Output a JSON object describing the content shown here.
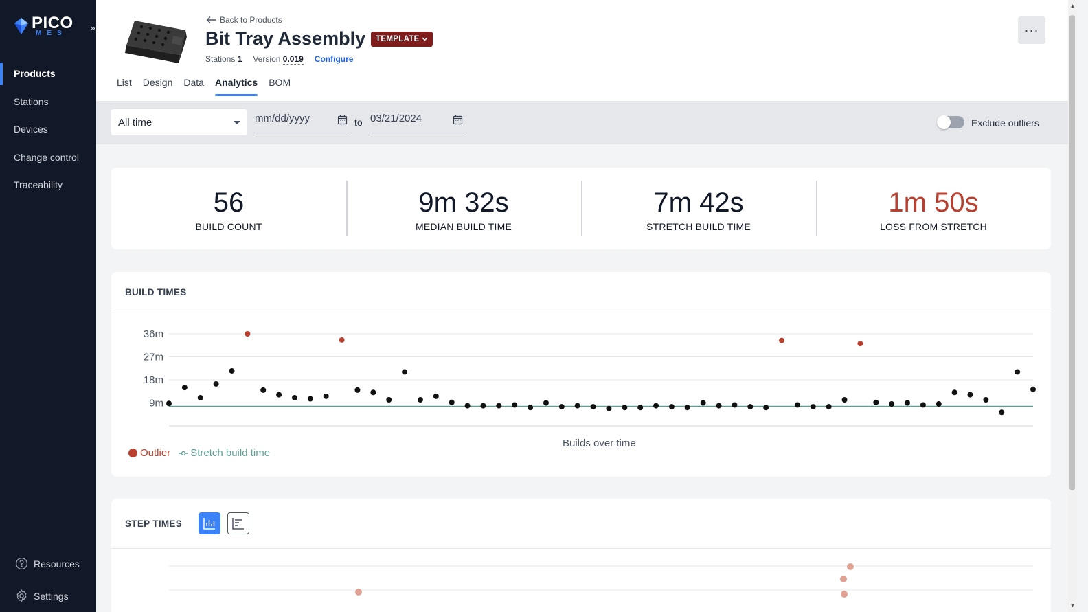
{
  "sidebar": {
    "logo_primary": "PICO",
    "logo_secondary": "MES",
    "collapse_icon": "»",
    "items": [
      {
        "label": "Products",
        "active": true
      },
      {
        "label": "Stations",
        "active": false
      },
      {
        "label": "Devices",
        "active": false
      },
      {
        "label": "Change control",
        "active": false
      },
      {
        "label": "Traceability",
        "active": false
      }
    ],
    "bottom_items": [
      {
        "label": "Resources",
        "icon": "help-circle-icon"
      },
      {
        "label": "Settings",
        "icon": "gear-icon"
      }
    ]
  },
  "header": {
    "back_link": "Back to Products",
    "title": "Bit Tray Assembly",
    "badge": "TEMPLATE",
    "stations_label": "Stations",
    "stations_value": "1",
    "version_label": "Version",
    "version_value": "0.019",
    "configure_label": "Configure",
    "more_label": "···",
    "tabs": [
      {
        "label": "List",
        "active": false
      },
      {
        "label": "Design",
        "active": false
      },
      {
        "label": "Data",
        "active": false
      },
      {
        "label": "Analytics",
        "active": true
      },
      {
        "label": "BOM",
        "active": false
      }
    ]
  },
  "filters": {
    "range_select": "All time",
    "date_from_placeholder": "mm/dd/yyyy",
    "to_label": "to",
    "date_to_value": "03/21/2024",
    "exclude_outliers_label": "Exclude outliers",
    "exclude_outliers_on": false
  },
  "stats": [
    {
      "value": "56",
      "label": "BUILD COUNT",
      "highlight": false
    },
    {
      "value": "9m 32s",
      "label": "MEDIAN BUILD TIME",
      "highlight": false
    },
    {
      "value": "7m 42s",
      "label": "STRETCH BUILD TIME",
      "highlight": false
    },
    {
      "value": "1m 50s",
      "label": "LOSS FROM STRETCH",
      "highlight": true
    }
  ],
  "colors": {
    "accent": "#3b82f6",
    "outlier": "#b9402f",
    "stretch": "#5e9f94",
    "point": "#111111",
    "loss": "#b9402f"
  },
  "build_times": {
    "section_title": "BUILD TIMES",
    "legend_outlier": "Outlier",
    "legend_stretch": "Stretch build time",
    "chart_data": {
      "type": "scatter",
      "xlabel": "Builds over time",
      "ylabel": "",
      "y_unit": "minutes",
      "yticks": [
        9,
        18,
        27,
        36
      ],
      "ytick_labels": [
        "9m",
        "18m",
        "27m",
        "36m"
      ],
      "ylim": [
        0,
        38
      ],
      "stretch_minutes": 7.7,
      "points": [
        {
          "i": 0,
          "y": 8.8,
          "outlier": false
        },
        {
          "i": 1,
          "y": 15.0,
          "outlier": false
        },
        {
          "i": 2,
          "y": 11.0,
          "outlier": false
        },
        {
          "i": 3,
          "y": 16.4,
          "outlier": false
        },
        {
          "i": 4,
          "y": 21.5,
          "outlier": false
        },
        {
          "i": 5,
          "y": 36.0,
          "outlier": true
        },
        {
          "i": 6,
          "y": 14.0,
          "outlier": false
        },
        {
          "i": 7,
          "y": 12.2,
          "outlier": false
        },
        {
          "i": 8,
          "y": 11.0,
          "outlier": false
        },
        {
          "i": 9,
          "y": 10.6,
          "outlier": false
        },
        {
          "i": 10,
          "y": 11.6,
          "outlier": false
        },
        {
          "i": 11,
          "y": 33.6,
          "outlier": true
        },
        {
          "i": 12,
          "y": 14.0,
          "outlier": false
        },
        {
          "i": 13,
          "y": 13.1,
          "outlier": false
        },
        {
          "i": 14,
          "y": 10.2,
          "outlier": false
        },
        {
          "i": 15,
          "y": 21.1,
          "outlier": false
        },
        {
          "i": 16,
          "y": 10.2,
          "outlier": false
        },
        {
          "i": 17,
          "y": 11.6,
          "outlier": false
        },
        {
          "i": 18,
          "y": 9.2,
          "outlier": false
        },
        {
          "i": 19,
          "y": 7.9,
          "outlier": false
        },
        {
          "i": 20,
          "y": 7.9,
          "outlier": false
        },
        {
          "i": 21,
          "y": 7.9,
          "outlier": false
        },
        {
          "i": 22,
          "y": 8.2,
          "outlier": false
        },
        {
          "i": 23,
          "y": 7.2,
          "outlier": false
        },
        {
          "i": 24,
          "y": 9.0,
          "outlier": false
        },
        {
          "i": 25,
          "y": 7.5,
          "outlier": false
        },
        {
          "i": 26,
          "y": 7.9,
          "outlier": false
        },
        {
          "i": 27,
          "y": 7.5,
          "outlier": false
        },
        {
          "i": 28,
          "y": 6.8,
          "outlier": false
        },
        {
          "i": 29,
          "y": 7.2,
          "outlier": false
        },
        {
          "i": 30,
          "y": 7.2,
          "outlier": false
        },
        {
          "i": 31,
          "y": 7.9,
          "outlier": false
        },
        {
          "i": 32,
          "y": 7.5,
          "outlier": false
        },
        {
          "i": 33,
          "y": 7.2,
          "outlier": false
        },
        {
          "i": 34,
          "y": 9.0,
          "outlier": false
        },
        {
          "i": 35,
          "y": 7.9,
          "outlier": false
        },
        {
          "i": 36,
          "y": 8.2,
          "outlier": false
        },
        {
          "i": 37,
          "y": 7.5,
          "outlier": false
        },
        {
          "i": 38,
          "y": 7.2,
          "outlier": false
        },
        {
          "i": 39,
          "y": 33.4,
          "outlier": true
        },
        {
          "i": 40,
          "y": 8.2,
          "outlier": false
        },
        {
          "i": 41,
          "y": 7.5,
          "outlier": false
        },
        {
          "i": 42,
          "y": 7.5,
          "outlier": false
        },
        {
          "i": 43,
          "y": 10.2,
          "outlier": false
        },
        {
          "i": 44,
          "y": 32.2,
          "outlier": true
        },
        {
          "i": 45,
          "y": 9.2,
          "outlier": false
        },
        {
          "i": 46,
          "y": 8.6,
          "outlier": false
        },
        {
          "i": 47,
          "y": 9.0,
          "outlier": false
        },
        {
          "i": 48,
          "y": 8.2,
          "outlier": false
        },
        {
          "i": 49,
          "y": 8.6,
          "outlier": false
        },
        {
          "i": 50,
          "y": 13.1,
          "outlier": false
        },
        {
          "i": 51,
          "y": 12.2,
          "outlier": false
        },
        {
          "i": 52,
          "y": 10.2,
          "outlier": false
        },
        {
          "i": 53,
          "y": 5.3,
          "outlier": false
        },
        {
          "i": 54,
          "y": 21.1,
          "outlier": false
        },
        {
          "i": 55,
          "y": 14.3,
          "outlier": false
        }
      ]
    }
  },
  "step_times": {
    "section_title": "STEP TIMES",
    "view_buttons": [
      {
        "name": "chart-view-button",
        "icon": "bar-chart-icon",
        "active": true
      },
      {
        "name": "list-view-button",
        "icon": "list-view-icon",
        "active": false
      }
    ]
  }
}
